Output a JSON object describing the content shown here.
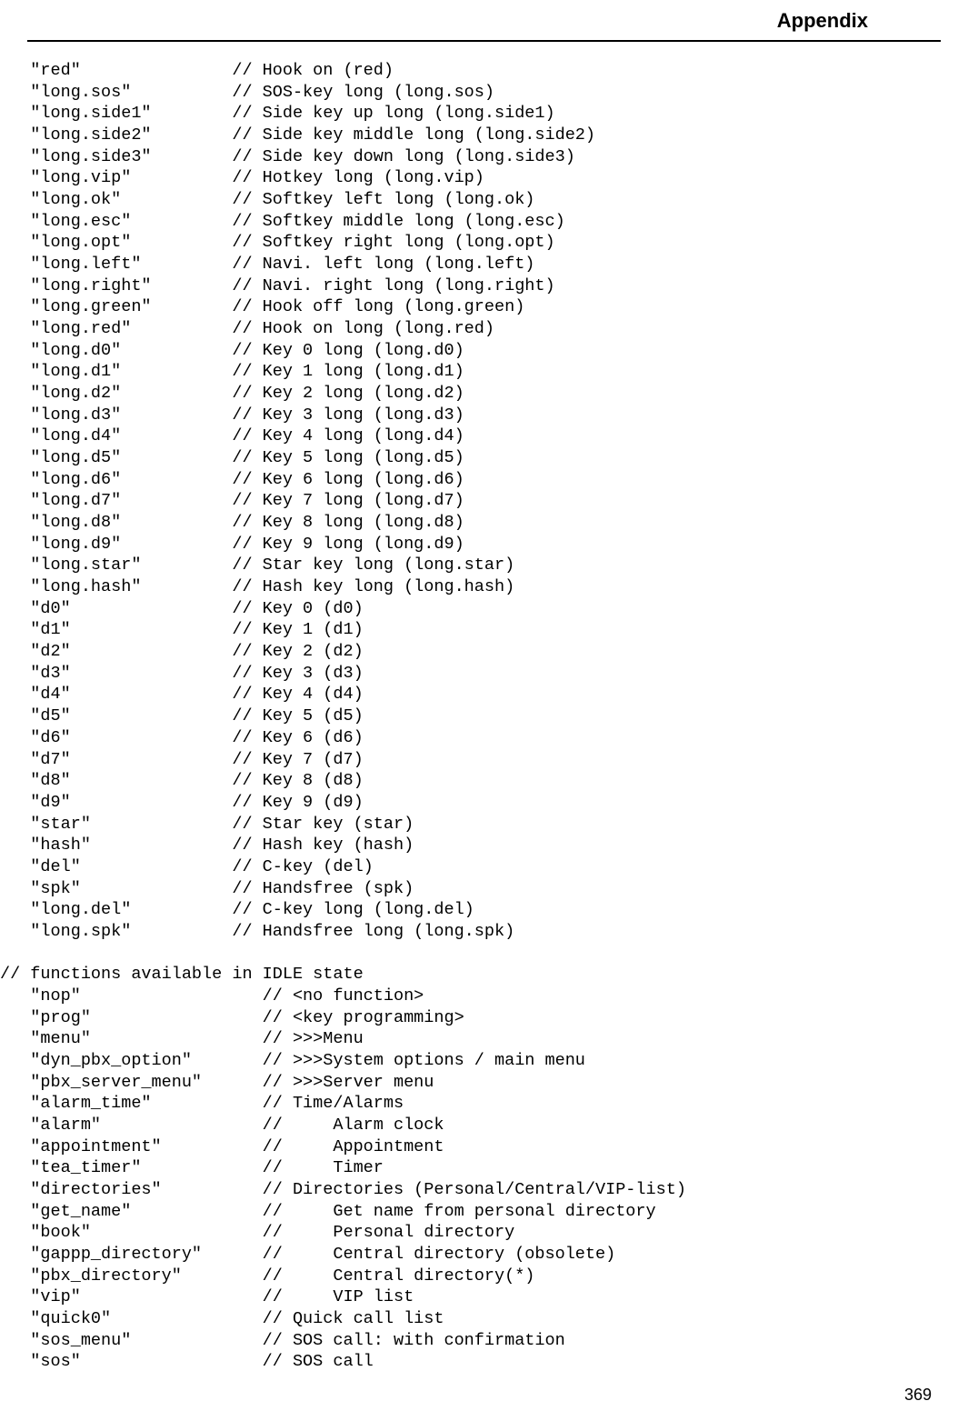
{
  "header": {
    "title": "Appendix"
  },
  "keys": [
    {
      "key": "\"red\"",
      "comment": "// Hook on (red)"
    },
    {
      "key": "\"long.sos\"",
      "comment": "// SOS-key long (long.sos)"
    },
    {
      "key": "\"long.side1\"",
      "comment": "// Side key up long (long.side1)"
    },
    {
      "key": "\"long.side2\"",
      "comment": "// Side key middle long (long.side2)"
    },
    {
      "key": "\"long.side3\"",
      "comment": "// Side key down long (long.side3)"
    },
    {
      "key": "\"long.vip\"",
      "comment": "// Hotkey long (long.vip)"
    },
    {
      "key": "\"long.ok\"",
      "comment": "// Softkey left long (long.ok)"
    },
    {
      "key": "\"long.esc\"",
      "comment": "// Softkey middle long (long.esc)"
    },
    {
      "key": "\"long.opt\"",
      "comment": "// Softkey right long (long.opt)"
    },
    {
      "key": "\"long.left\"",
      "comment": "// Navi. left long (long.left)"
    },
    {
      "key": "\"long.right\"",
      "comment": "// Navi. right long (long.right)"
    },
    {
      "key": "\"long.green\"",
      "comment": "// Hook off long (long.green)"
    },
    {
      "key": "\"long.red\"",
      "comment": "// Hook on long (long.red)"
    },
    {
      "key": "\"long.d0\"",
      "comment": "// Key 0 long (long.d0)"
    },
    {
      "key": "\"long.d1\"",
      "comment": "// Key 1 long (long.d1)"
    },
    {
      "key": "\"long.d2\"",
      "comment": "// Key 2 long (long.d2)"
    },
    {
      "key": "\"long.d3\"",
      "comment": "// Key 3 long (long.d3)"
    },
    {
      "key": "\"long.d4\"",
      "comment": "// Key 4 long (long.d4)"
    },
    {
      "key": "\"long.d5\"",
      "comment": "// Key 5 long (long.d5)"
    },
    {
      "key": "\"long.d6\"",
      "comment": "// Key 6 long (long.d6)"
    },
    {
      "key": "\"long.d7\"",
      "comment": "// Key 7 long (long.d7)"
    },
    {
      "key": "\"long.d8\"",
      "comment": "// Key 8 long (long.d8)"
    },
    {
      "key": "\"long.d9\"",
      "comment": "// Key 9 long (long.d9)"
    },
    {
      "key": "\"long.star\"",
      "comment": "// Star key long (long.star)"
    },
    {
      "key": "\"long.hash\"",
      "comment": "// Hash key long (long.hash)"
    },
    {
      "key": "\"d0\"",
      "comment": "// Key 0 (d0)"
    },
    {
      "key": "\"d1\"",
      "comment": "// Key 1 (d1)"
    },
    {
      "key": "\"d2\"",
      "comment": "// Key 2 (d2)"
    },
    {
      "key": "\"d3\"",
      "comment": "// Key 3 (d3)"
    },
    {
      "key": "\"d4\"",
      "comment": "// Key 4 (d4)"
    },
    {
      "key": "\"d5\"",
      "comment": "// Key 5 (d5)"
    },
    {
      "key": "\"d6\"",
      "comment": "// Key 6 (d6)"
    },
    {
      "key": "\"d7\"",
      "comment": "// Key 7 (d7)"
    },
    {
      "key": "\"d8\"",
      "comment": "// Key 8 (d8)"
    },
    {
      "key": "\"d9\"",
      "comment": "// Key 9 (d9)"
    },
    {
      "key": "\"star\"",
      "comment": "// Star key (star)"
    },
    {
      "key": "\"hash\"",
      "comment": "// Hash key (hash)"
    },
    {
      "key": "\"del\"",
      "comment": "// C-key (del)"
    },
    {
      "key": "\"spk\"",
      "comment": "// Handsfree (spk)"
    },
    {
      "key": "\"long.del\"",
      "comment": "// C-key long (long.del)"
    },
    {
      "key": "\"long.spk\"",
      "comment": "// Handsfree long (long.spk)"
    }
  ],
  "section_comment": "// functions available in IDLE state",
  "functions": [
    {
      "key": "\"nop\"",
      "comment": "// <no function>"
    },
    {
      "key": "\"prog\"",
      "comment": "// <key programming>"
    },
    {
      "key": "\"menu\"",
      "comment": "// >>>Menu"
    },
    {
      "key": "\"dyn_pbx_option\"",
      "comment": "// >>>System options / main menu"
    },
    {
      "key": "\"pbx_server_menu\"",
      "comment": "// >>>Server menu"
    },
    {
      "key": "\"alarm_time\"",
      "comment": "// Time/Alarms"
    },
    {
      "key": "\"alarm\"",
      "comment": "//     Alarm clock"
    },
    {
      "key": "\"appointment\"",
      "comment": "//     Appointment"
    },
    {
      "key": "\"tea_timer\"",
      "comment": "//     Timer"
    },
    {
      "key": "\"directories\"",
      "comment": "// Directories (Personal/Central/VIP-list)"
    },
    {
      "key": "\"get_name\"",
      "comment": "//     Get name from personal directory"
    },
    {
      "key": "\"book\"",
      "comment": "//     Personal directory"
    },
    {
      "key": "\"gappp_directory\"",
      "comment": "//     Central directory (obsolete)"
    },
    {
      "key": "\"pbx_directory\"",
      "comment": "//     Central directory(*)"
    },
    {
      "key": "\"vip\"",
      "comment": "//     VIP list"
    },
    {
      "key": "\"quick0\"",
      "comment": "// Quick call list"
    },
    {
      "key": "\"sos_menu\"",
      "comment": "// SOS call: with confirmation"
    },
    {
      "key": "\"sos\"",
      "comment": "// SOS call"
    }
  ],
  "footer": {
    "page_number": "369"
  },
  "layout": {
    "keys_indent": "   ",
    "keys_col": 20,
    "funcs_indent": "   ",
    "funcs_col": 23
  }
}
